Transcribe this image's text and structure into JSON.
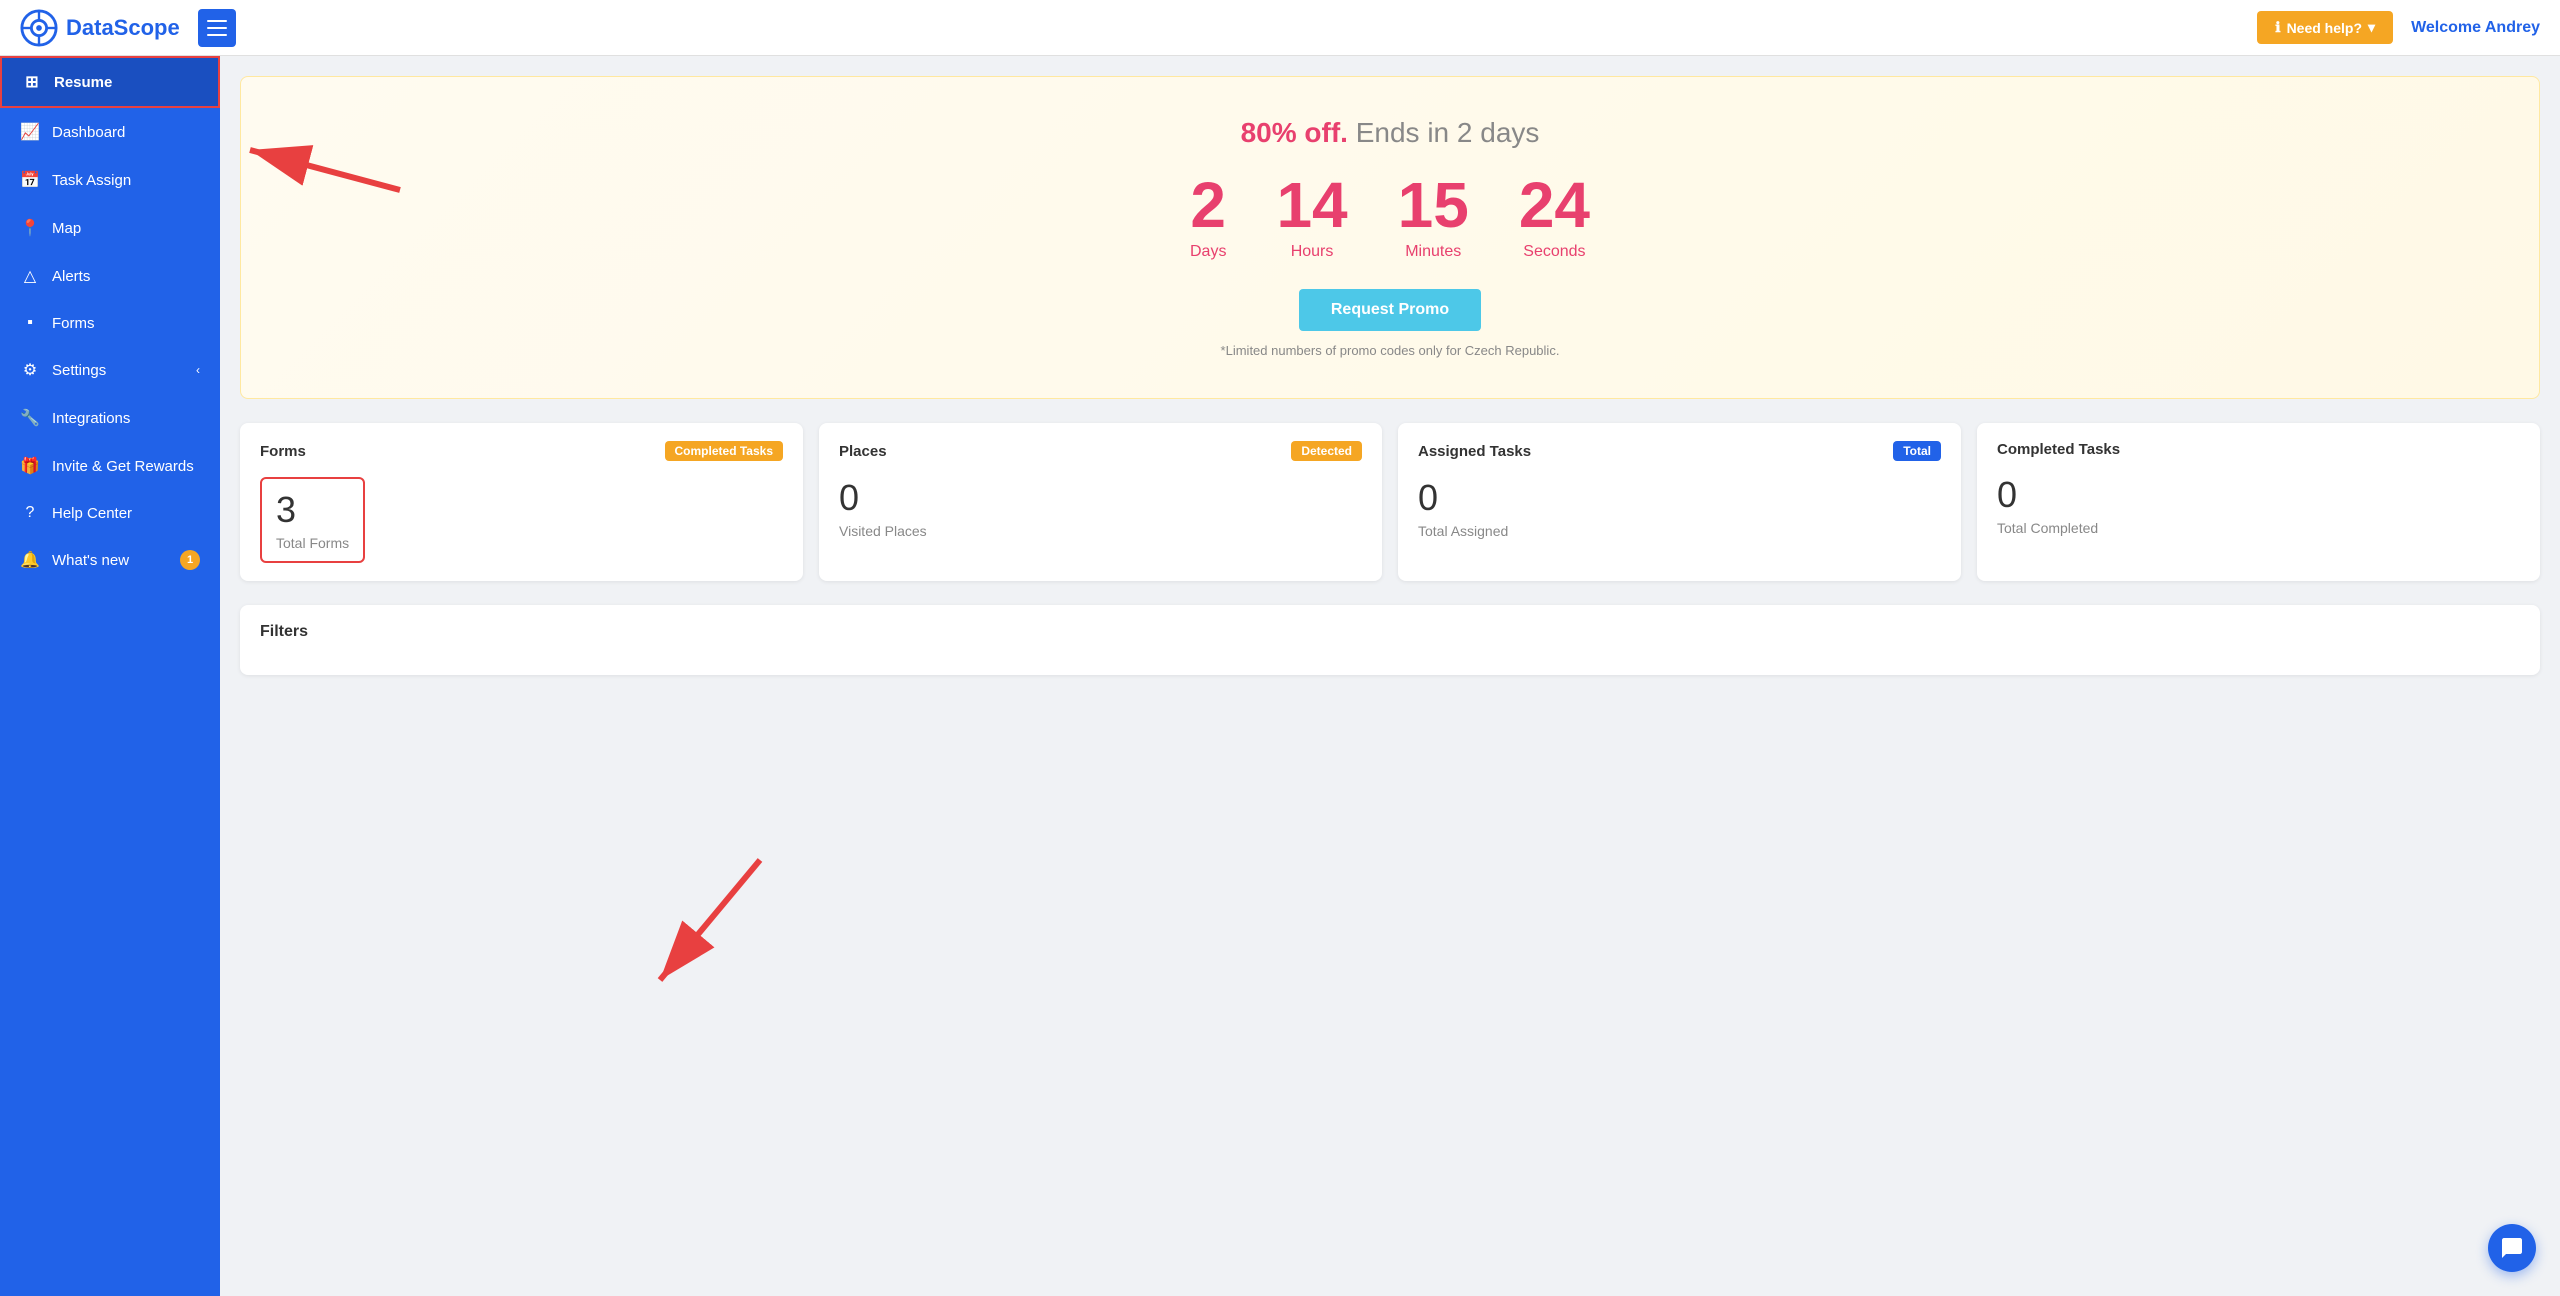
{
  "header": {
    "logo_text": "DataScope",
    "hamburger_label": "Menu",
    "need_help_label": "Need help?",
    "welcome_text": "Welcome Andrey"
  },
  "sidebar": {
    "items": [
      {
        "id": "resume",
        "label": "Resume",
        "icon": "⊞",
        "active": true
      },
      {
        "id": "dashboard",
        "label": "Dashboard",
        "icon": "📈"
      },
      {
        "id": "task-assign",
        "label": "Task Assign",
        "icon": "📅"
      },
      {
        "id": "map",
        "label": "Map",
        "icon": "📍"
      },
      {
        "id": "alerts",
        "label": "Alerts",
        "icon": "△"
      },
      {
        "id": "forms",
        "label": "Forms",
        "icon": "▪"
      },
      {
        "id": "settings",
        "label": "Settings",
        "icon": "⚙",
        "has_arrow": true
      },
      {
        "id": "integrations",
        "label": "Integrations",
        "icon": "🔧"
      },
      {
        "id": "invite-rewards",
        "label": "Invite & Get Rewards",
        "icon": "🎁"
      },
      {
        "id": "help-center",
        "label": "Help Center",
        "icon": "?"
      },
      {
        "id": "whats-new",
        "label": "What's new",
        "icon": "🔔",
        "badge": "1"
      }
    ]
  },
  "promo": {
    "title_prefix": "80% off.",
    "title_suffix": " Ends in 2 days",
    "days_value": "2",
    "days_label": "Days",
    "hours_value": "14",
    "hours_label": "Hours",
    "minutes_value": "15",
    "minutes_label": "Minutes",
    "seconds_value": "24",
    "seconds_label": "Seconds",
    "button_label": "Request Promo",
    "note": "*Limited numbers of promo codes only for Czech Republic."
  },
  "stats": [
    {
      "id": "forms",
      "title": "Forms",
      "badge_label": "Completed Tasks",
      "badge_class": "badge-orange",
      "value": "3",
      "label": "Total Forms",
      "highlighted": true
    },
    {
      "id": "places",
      "title": "Places",
      "badge_label": "Detected",
      "badge_class": "badge-orange",
      "value": "0",
      "label": "Visited Places",
      "highlighted": false
    },
    {
      "id": "assigned-tasks",
      "title": "Assigned Tasks",
      "badge_label": "Total",
      "badge_class": "badge-blue",
      "value": "0",
      "label": "Total Assigned",
      "highlighted": false
    },
    {
      "id": "completed-tasks",
      "title": "Completed Tasks",
      "badge_label": "",
      "badge_class": "",
      "value": "0",
      "label": "Total Completed",
      "highlighted": false
    }
  ],
  "filters": {
    "title": "Filters"
  },
  "chat_button": {
    "label": "Chat"
  }
}
